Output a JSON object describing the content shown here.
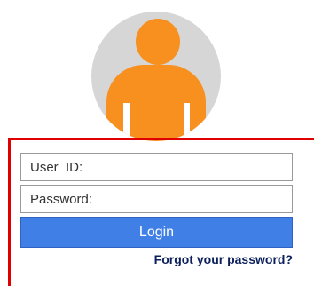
{
  "avatar": {
    "icon": "user-icon",
    "background_color": "#d6d6d6",
    "figure_color": "#f7901e"
  },
  "login": {
    "frame_color": "#e00000",
    "user_id_placeholder": "User  ID:",
    "password_placeholder": "Password:",
    "button_label": "Login",
    "button_color": "#3f7fe6",
    "forgot_password_label": "Forgot your password?"
  }
}
